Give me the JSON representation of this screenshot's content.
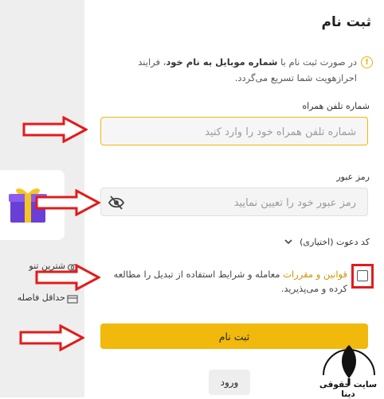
{
  "page": {
    "title": "ثبت نام",
    "info_icon": "info-icon",
    "info_text_before": "در صورت ثبت نام با ",
    "info_text_bold": "شماره موبایل به نام خود",
    "info_text_after": "، فرایند احرازهویت شما تسریع می‌گردد."
  },
  "sidebar": {
    "item1_label": "شترین تنو",
    "item1_icon": "link-icon",
    "item2_label": "حداقل فاصله",
    "item2_icon": "card-icon",
    "promo_icon": "gift-icon"
  },
  "form": {
    "phone_label": "شماره تلفن همراه",
    "phone_placeholder": "شماره تلفن همراه خود را وارد کنید",
    "password_label": "رمز عبور",
    "password_placeholder": "رمز عبور خود را تعیین نمایید",
    "password_icon": "eye-off-icon",
    "invite_label": "کد دعوت (اختیاری)",
    "invite_icon": "chevron-down-icon",
    "terms_link": "قوانین و مقررات",
    "terms_text": " معامله و شرایط استفاده از تبدیل را مطالعه کرده و می‌پذیرید.",
    "submit_label": "ثبت نام",
    "login_label": "ورود"
  },
  "watermark": {
    "text": "سایت حقوقی دینا"
  },
  "colors": {
    "accent": "#f0b90b",
    "annotation_red": "#e31b1b"
  }
}
